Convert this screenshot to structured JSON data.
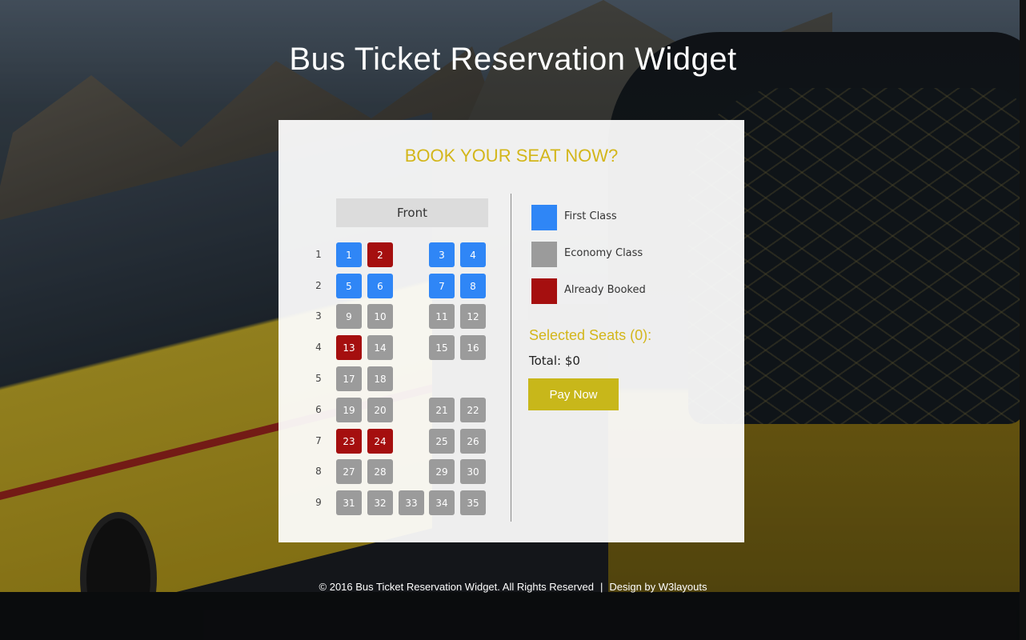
{
  "page": {
    "title": "Bus Ticket Reservation Widget"
  },
  "card": {
    "heading": "BOOK YOUR SEAT NOW?",
    "front_label": "Front"
  },
  "seat_map": {
    "row_numbers": [
      "1",
      "2",
      "3",
      "4",
      "5",
      "6",
      "7",
      "8",
      "9"
    ],
    "seats": [
      {
        "label": "1",
        "class": "first"
      },
      {
        "label": "2",
        "class": "booked"
      },
      {
        "label": "3",
        "class": "first"
      },
      {
        "label": "4",
        "class": "first"
      },
      {
        "label": "5",
        "class": "first"
      },
      {
        "label": "6",
        "class": "first"
      },
      {
        "label": "7",
        "class": "first"
      },
      {
        "label": "8",
        "class": "first"
      },
      {
        "label": "9",
        "class": "economy"
      },
      {
        "label": "10",
        "class": "economy"
      },
      {
        "label": "11",
        "class": "economy"
      },
      {
        "label": "12",
        "class": "economy"
      },
      {
        "label": "13",
        "class": "booked"
      },
      {
        "label": "14",
        "class": "economy"
      },
      {
        "label": "15",
        "class": "economy"
      },
      {
        "label": "16",
        "class": "economy"
      },
      {
        "label": "17",
        "class": "economy"
      },
      {
        "label": "18",
        "class": "economy"
      },
      {
        "label": "19",
        "class": "economy"
      },
      {
        "label": "20",
        "class": "economy"
      },
      {
        "label": "21",
        "class": "economy"
      },
      {
        "label": "22",
        "class": "economy"
      },
      {
        "label": "23",
        "class": "booked"
      },
      {
        "label": "24",
        "class": "booked"
      },
      {
        "label": "25",
        "class": "economy"
      },
      {
        "label": "26",
        "class": "economy"
      },
      {
        "label": "27",
        "class": "economy"
      },
      {
        "label": "28",
        "class": "economy"
      },
      {
        "label": "29",
        "class": "economy"
      },
      {
        "label": "30",
        "class": "economy"
      },
      {
        "label": "31",
        "class": "economy"
      },
      {
        "label": "32",
        "class": "economy"
      },
      {
        "label": "33",
        "class": "economy"
      },
      {
        "label": "34",
        "class": "economy"
      },
      {
        "label": "35",
        "class": "economy"
      }
    ]
  },
  "legend": {
    "first_class": "First Class",
    "economy_class": "Economy Class",
    "already_booked": "Already Booked"
  },
  "summary": {
    "selected_seats": "Selected Seats (0):",
    "total": "Total: $0",
    "pay_button": "Pay Now"
  },
  "colors": {
    "first_class": "#2f86f6",
    "economy_class": "#9b9b9b",
    "already_booked": "#a50f0f",
    "accent": "#d3b61a"
  },
  "footer": {
    "copyright": "© 2016 Bus Ticket Reservation Widget. All Rights Reserved",
    "separator": "|",
    "design_credit": "Design by W3layouts"
  }
}
